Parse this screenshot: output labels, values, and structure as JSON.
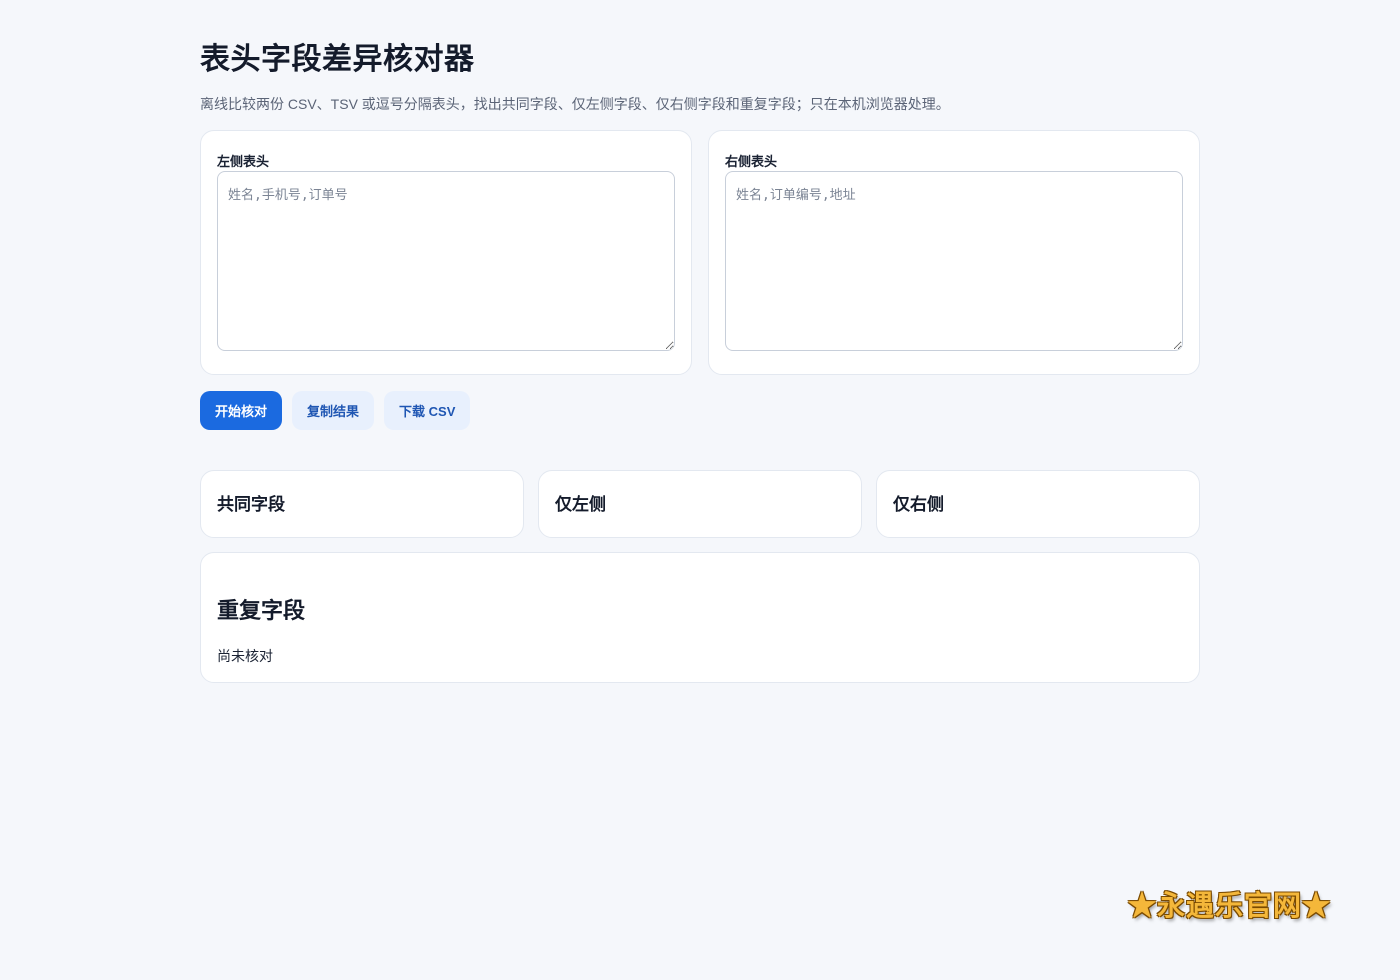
{
  "page": {
    "title": "表头字段差异核对器",
    "subtitle": "离线比较两份 CSV、TSV 或逗号分隔表头，找出共同字段、仅左侧字段、仅右侧字段和重复字段；只在本机浏览器处理。"
  },
  "inputs": {
    "left": {
      "label": "左侧表头",
      "placeholder": "姓名,手机号,订单号",
      "value": ""
    },
    "right": {
      "label": "右侧表头",
      "placeholder": "姓名,订单编号,地址",
      "value": ""
    }
  },
  "actions": {
    "compare_label": "开始核对",
    "copy_label": "复制结果",
    "download_label": "下载 CSV"
  },
  "results": {
    "common_title": "共同字段",
    "left_only_title": "仅左侧",
    "right_only_title": "仅右侧"
  },
  "duplicates": {
    "title": "重复字段",
    "status": "尚未核对"
  },
  "watermark": {
    "text": "★永遇乐官网★"
  },
  "colors": {
    "background": "#f5f7fb",
    "primary": "#1b6ae0",
    "secondary_bg": "#e8f0fd",
    "secondary_text": "#1f56b3"
  }
}
